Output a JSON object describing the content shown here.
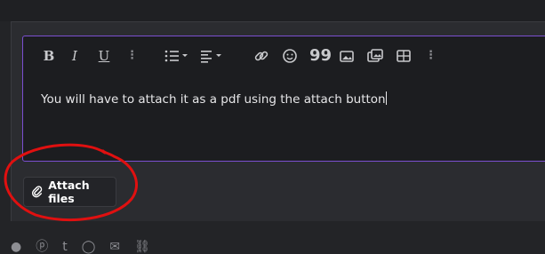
{
  "editor": {
    "toolbar": [
      {
        "name": "bold-button",
        "label": "B"
      },
      {
        "name": "italic-button",
        "label": "I"
      },
      {
        "name": "underline-button",
        "label": "U"
      },
      {
        "name": "more-text-options",
        "icon": "vertical-dots-icon"
      },
      {
        "name": "list-button",
        "icon": "list-icon"
      },
      {
        "name": "align-button",
        "icon": "align-icon"
      },
      {
        "name": "link-button",
        "icon": "link-icon"
      },
      {
        "name": "emoji-button",
        "icon": "smile-icon"
      },
      {
        "name": "quote-button",
        "icon": "quote-icon"
      },
      {
        "name": "image-button",
        "icon": "image-icon"
      },
      {
        "name": "media-button",
        "icon": "media-icon"
      },
      {
        "name": "table-button",
        "icon": "table-icon"
      },
      {
        "name": "more-options",
        "icon": "vertical-dots-icon"
      }
    ],
    "content": "You will have to attach it as a pdf using the attach button",
    "border_color": "#7b4fd0"
  },
  "attach": {
    "label": "Attach files",
    "icon": "paperclip-icon"
  },
  "annotation": {
    "color": "#e01010",
    "shape": "hand-drawn-circle"
  },
  "share_icons": [
    "reddit-icon",
    "pinterest-icon",
    "tumblr-icon",
    "whatsapp-icon",
    "email-icon",
    "link-icon"
  ]
}
